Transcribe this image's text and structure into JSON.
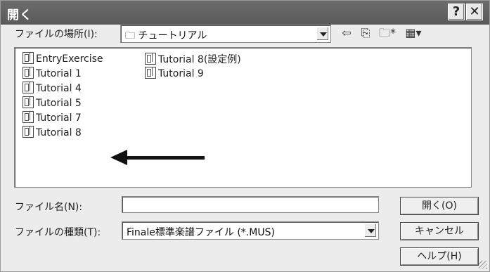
{
  "window": {
    "title": "開く",
    "help_button": "?",
    "close_button": "✕"
  },
  "look_in": {
    "label": "ファイルの場所(I):",
    "value": "チュートリアル"
  },
  "files": {
    "column1": [
      "EntryExercise",
      "Tutorial 1",
      "Tutorial 4",
      "Tutorial 5",
      "Tutorial 7",
      "Tutorial 8"
    ],
    "column2": [
      "Tutorial 8(設定例)",
      "Tutorial 9"
    ]
  },
  "filename": {
    "label": "ファイル名(N):",
    "value": ""
  },
  "filetype": {
    "label": "ファイルの種類(T):",
    "value": "Finale標準楽譜ファイル (*.MUS)"
  },
  "buttons": {
    "open": "開く(O)",
    "cancel": "キャンセル",
    "help": "ヘルプ(H)"
  },
  "colors": {
    "titlebar": "#5f5f5f",
    "annotation_arrow": "#111111"
  },
  "icons": [
    "folder-icon",
    "back-arrow-icon",
    "up-folder-icon",
    "new-folder-icon",
    "view-menu-icon",
    "file-icon"
  ]
}
